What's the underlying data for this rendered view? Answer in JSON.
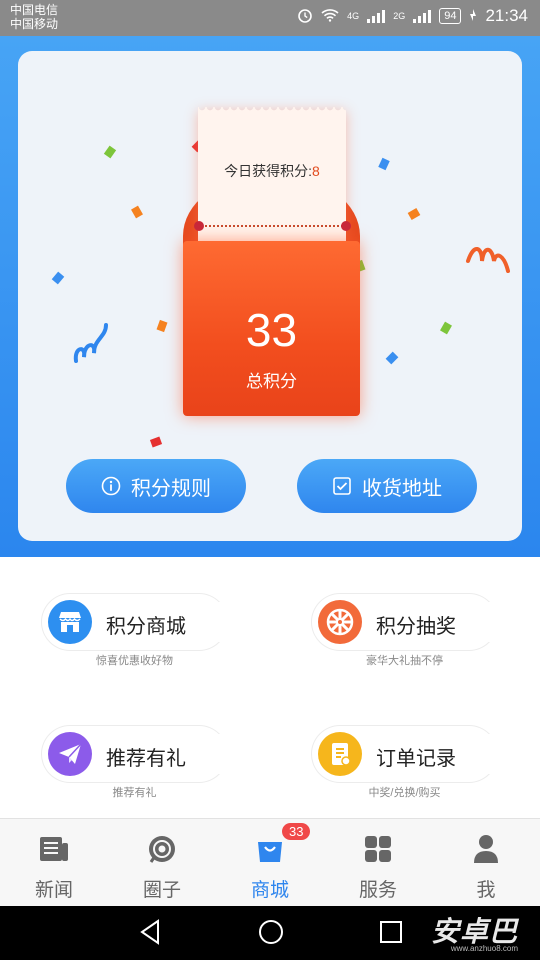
{
  "status_bar": {
    "carrier1": "中国电信",
    "carrier2": "中国移动",
    "net_a": "4G",
    "net_b": "2G",
    "net_c": "2G",
    "battery": "94",
    "time": "21:34"
  },
  "points": {
    "today_label": "今日获得积分:",
    "today_value": "8",
    "total_value": "33",
    "total_label": "总积分"
  },
  "actions": {
    "rules_label": "积分规则",
    "address_label": "收货地址"
  },
  "menu": [
    {
      "label": "积分商城",
      "sub": "惊喜优惠收好物",
      "icon": "store-icon",
      "color": "#2d8ff0"
    },
    {
      "label": "积分抽奖",
      "sub": "豪华大礼抽不停",
      "icon": "lottery-wheel-icon",
      "color": "#f26a3a"
    },
    {
      "label": "推荐有礼",
      "sub": "推荐有礼",
      "icon": "paper-plane-icon",
      "color": "#8c5bea"
    },
    {
      "label": "订单记录",
      "sub": "中奖/兑换/购买",
      "icon": "order-record-icon",
      "color": "#f6b61c"
    }
  ],
  "tabs": [
    {
      "label": "新闻",
      "icon": "news-icon"
    },
    {
      "label": "圈子",
      "icon": "circle-icon"
    },
    {
      "label": "商城",
      "icon": "shopping-bag-icon",
      "badge": "33",
      "active": true
    },
    {
      "label": "服务",
      "icon": "grid-icon"
    },
    {
      "label": "我",
      "icon": "user-icon"
    }
  ],
  "watermark": {
    "main": "安卓巴",
    "sub": "www.anzhuo8.com"
  },
  "colors": {
    "brand_blue": "#2f86ee",
    "envelope_red": "#f24e1e",
    "badge_red": "#f04848"
  }
}
